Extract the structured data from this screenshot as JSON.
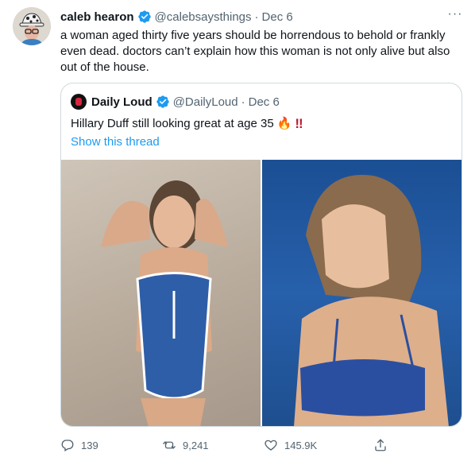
{
  "tweet": {
    "author_name": "caleb hearon",
    "author_handle": "@calebsaysthings",
    "separator": "·",
    "date": "Dec 6",
    "more_label": "···",
    "text": "a woman aged thirty five years should be horrendous to behold or frankly even dead. doctors can’t explain how this woman is not only alive but also out of the house.",
    "avatar_icon": "avatar-with-patterned-hat-and-glasses"
  },
  "quote": {
    "author_name": "Daily Loud",
    "author_handle": "@DailyLoud",
    "separator": "·",
    "date": "Dec 6",
    "text": "Hillary Duff still looking great at age 35",
    "emoji_fire": "🔥",
    "emoji_bang": "‼",
    "show_thread": "Show this thread",
    "images": [
      {
        "description_icon": "photo-blue-zip-swimsuit"
      },
      {
        "description_icon": "photo-blue-bikini-top"
      }
    ]
  },
  "actions": {
    "reply_count": "139",
    "retweet_count": "9,241",
    "like_count": "145.9K"
  },
  "colors": {
    "text_primary": "#0f1419",
    "text_muted": "#536471",
    "link": "#1d9bf0",
    "verified": "#1d9bf0",
    "border": "#cfd9de"
  }
}
